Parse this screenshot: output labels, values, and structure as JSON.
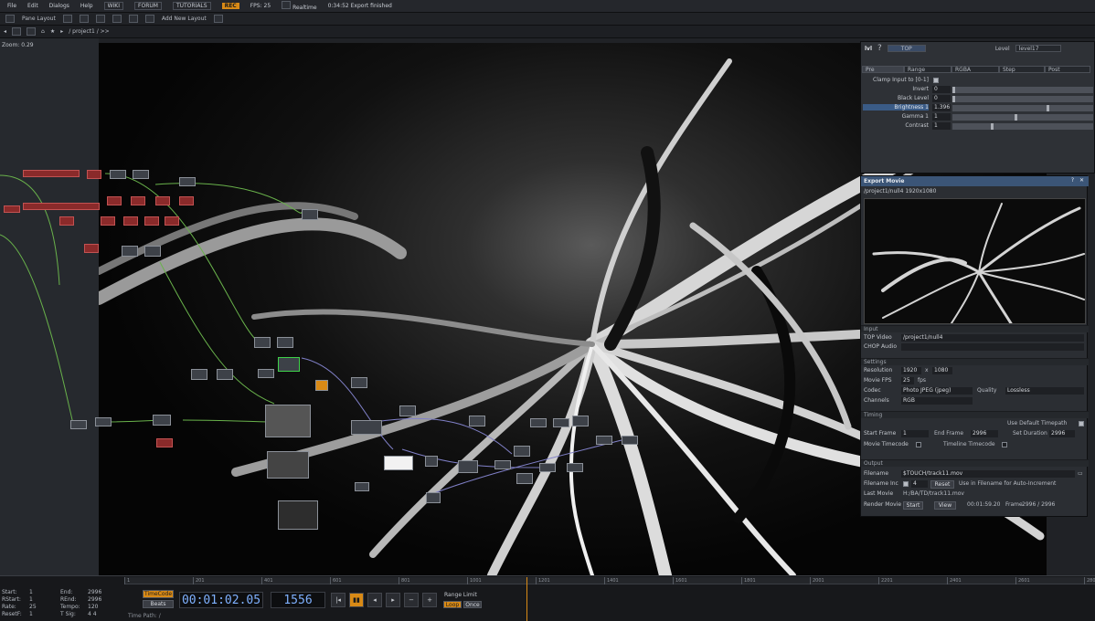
{
  "menubar": {
    "items": [
      "File",
      "Edit",
      "Dialogs",
      "Help"
    ],
    "tags": [
      "WIKI",
      "FORUM",
      "TUTORIALS"
    ],
    "rec": "REC",
    "fps_label": "FPS:",
    "fps_value": "25",
    "realtime_label": "Realtime",
    "status": "0:34:52 Export finished"
  },
  "toolbar": {
    "pane_layout": "Pane Layout",
    "add_layout": "Add New Layout"
  },
  "pathbar": {
    "path": "/ project1 / >>"
  },
  "network": {
    "zoom": "Zoom: 0.29"
  },
  "params": {
    "op_name": "lvl",
    "op_type": "TOP",
    "level_label": "Level",
    "level_value": "level17",
    "tabs": [
      "Pre",
      "Range",
      "RGBA",
      "Step",
      "Post"
    ],
    "clamp_label": "Clamp Input to [0-1]",
    "rows": [
      {
        "label": "Invert",
        "value": "0",
        "level": 0.0
      },
      {
        "label": "Black Level",
        "value": "0",
        "level": 0.0
      },
      {
        "label": "Brightness 1",
        "value": "1.396",
        "level": 0.68
      },
      {
        "label": "Gamma 1",
        "value": "1",
        "level": 0.45
      },
      {
        "label": "Contrast",
        "value": "1",
        "level": 0.28
      }
    ]
  },
  "export": {
    "title": "Export Movie",
    "subtitle": "/project1/null4 1920x1080",
    "sections": {
      "input": "Input",
      "settings": "Settings",
      "timing": "Timing",
      "output": "Output"
    },
    "top_video_label": "TOP Video",
    "top_video_value": "/project1/null4",
    "chop_audio_label": "CHOP Audio",
    "resolution_label": "Resolution",
    "res_w": "1920",
    "res_x": "x",
    "res_h": "1080",
    "movie_fps_label": "Movie FPS",
    "movie_fps": "25",
    "fps_unit": "fps",
    "codec_label": "Codec",
    "codec": "Photo JPEG (jpeg)",
    "quality_label": "Quality",
    "quality": "Lossless",
    "channels_label": "Channels",
    "channels": "RGB",
    "use_default_timepath": "Use Default Timepath",
    "start_frame_label": "Start Frame",
    "start_frame": "1",
    "end_frame_label": "End Frame",
    "end_frame": "2996",
    "set_duration_label": "Set Duration",
    "set_duration": "2996",
    "movie_timecode": "Movie Timecode",
    "timeline_timecode": "Timeline Timecode",
    "filename_label": "Filename",
    "filename": "$TOUCH/track11.mov",
    "filename_inc_label": "Filename Inc",
    "filename_inc": "4",
    "reset": "Reset",
    "use_in_filename": "Use  in Filename for Auto-Increment",
    "last_movie_label": "Last Movie",
    "last_movie": "H:/BA/TD/track11.mov",
    "render_movie_label": "Render Movie",
    "start": "Start",
    "view": "View",
    "elapsed": "00:01:59.20",
    "frame_label": "Frame",
    "frame_value": "2996 / 2996"
  },
  "timeline": {
    "left": [
      {
        "k": "Start:",
        "v": "1"
      },
      {
        "k": "RStart:",
        "v": "1"
      },
      {
        "k": "Rate:",
        "v": "25"
      },
      {
        "k": "ResetF:",
        "v": "1"
      }
    ],
    "right": [
      {
        "k": "End:",
        "v": "2996"
      },
      {
        "k": "REnd:",
        "v": "2996"
      },
      {
        "k": "Tempo:",
        "v": "120"
      },
      {
        "k": "T Sig:",
        "v": "4     4"
      }
    ],
    "timecode_btn": "TimeCode",
    "beats_btn": "Beats",
    "time": "00:01:02.05",
    "frame": "1556",
    "range_limit": "Range Limit",
    "loop": "Loop",
    "once": "Once",
    "timepath": "Time Path: /",
    "ticks": [
      "1",
      "201",
      "401",
      "601",
      "801",
      "1001",
      "1201",
      "1401",
      "1601",
      "1801",
      "2001",
      "2201",
      "2401",
      "2601",
      "2801"
    ]
  },
  "colors": {
    "accent": "#d98a16",
    "selection": "#3a5b86",
    "timecode": "#7fb1ff",
    "wire": "#69b24b"
  }
}
